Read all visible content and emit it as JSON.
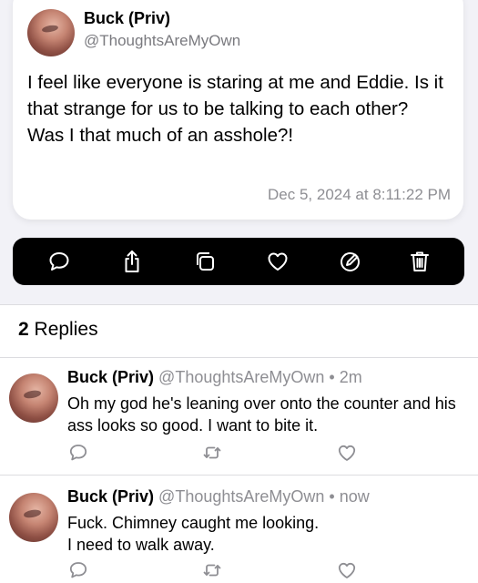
{
  "post": {
    "author_name": "Buck (Priv)",
    "author_handle": "@ThoughtsAreMyOwn",
    "text": "I feel like everyone is staring at me and Eddie. Is it that strange for us to be talking to each other?\nWas I that much of an asshole?!",
    "timestamp": "Dec 5, 2024 at 8:11:22 PM"
  },
  "action_bar": {
    "icons": [
      "comment-icon",
      "share-icon",
      "copy-icon",
      "heart-icon",
      "edit-icon",
      "trash-icon"
    ],
    "background": "#000000",
    "icon_color": "#ffffff"
  },
  "replies_section": {
    "count": "2",
    "label": "Replies"
  },
  "replies": [
    {
      "author_name": "Buck (Priv)",
      "author_handle": "@ThoughtsAreMyOwn",
      "separator": "•",
      "time": "2m",
      "text": "Oh my god he's leaning over onto the counter and his ass looks so good. I want to bite it."
    },
    {
      "author_name": "Buck (Priv)",
      "author_handle": "@ThoughtsAreMyOwn",
      "separator": "•",
      "time": "now",
      "text": "Fuck. Chimney caught me looking.\nI need to walk away."
    }
  ],
  "colors": {
    "background": "#f2f2f7",
    "secondary_text": "#8e8e93",
    "reply_icon": "#8e8e93"
  }
}
